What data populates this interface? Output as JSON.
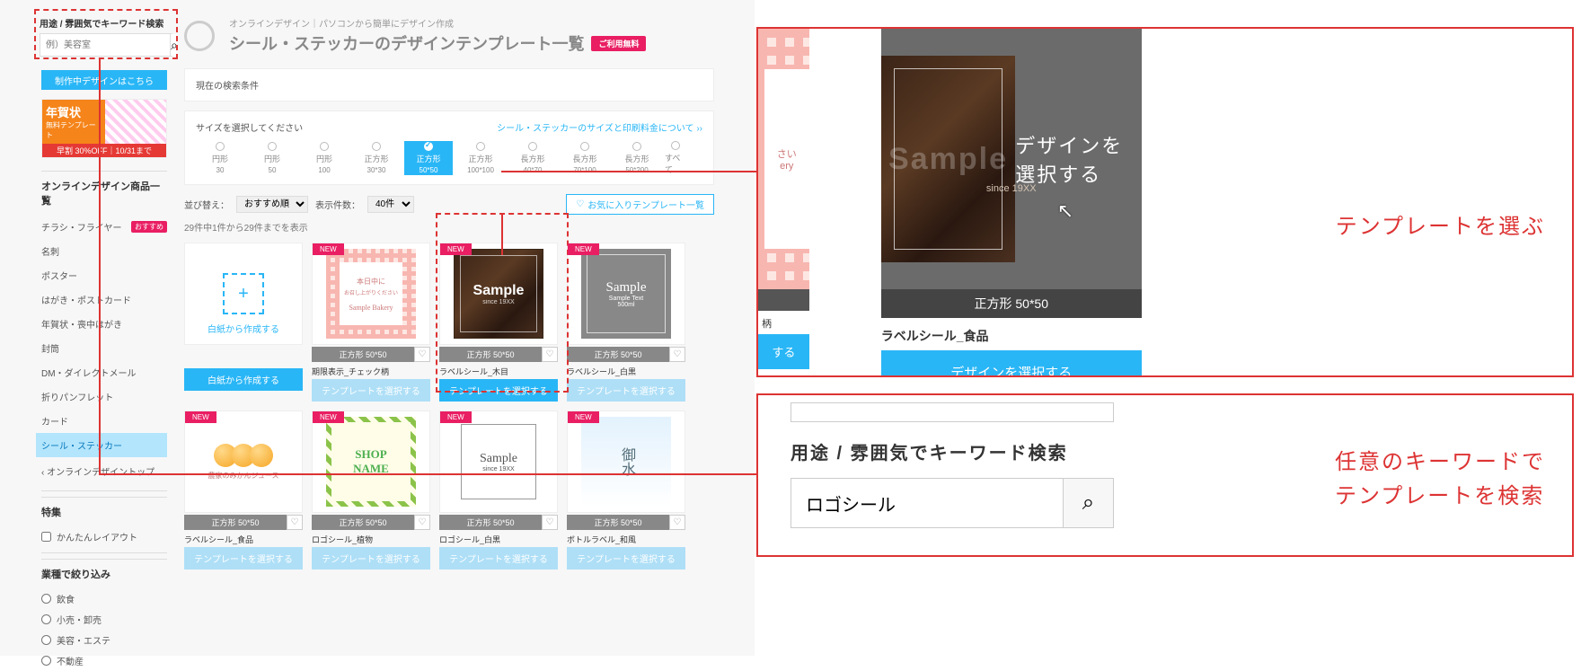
{
  "search": {
    "label": "用途 / 雰囲気でキーワード検索",
    "placeholder": "例）美容室"
  },
  "inprogress_btn": "制作中デザインはこちら",
  "promo": {
    "title": "年賀状",
    "subtitle": "無料テンプレート",
    "bottom": "早割 30%OFF｜10/31まで"
  },
  "header": {
    "breadcrumb": "オンラインデザイン｜パソコンから簡単にデザイン作成",
    "title": "シール・ステッカーのデザインテンプレート一覧",
    "free_badge": "ご利用無料"
  },
  "sidebar": {
    "products_title": "オンラインデザイン商品一覧",
    "items": [
      {
        "label": "チラシ・フライヤー",
        "badge": "おすすめ"
      },
      {
        "label": "名刺"
      },
      {
        "label": "ポスター"
      },
      {
        "label": "はがき・ポストカード"
      },
      {
        "label": "年賀状・喪中はがき"
      },
      {
        "label": "封筒"
      },
      {
        "label": "DM・ダイレクトメール"
      },
      {
        "label": "折りパンフレット"
      },
      {
        "label": "カード"
      },
      {
        "label": "シール・ステッカー",
        "active": true
      }
    ],
    "back": "オンラインデザイントップ",
    "feature_title": "特集",
    "feature_items": [
      "かんたんレイアウト"
    ],
    "industry_title": "業種で絞り込み",
    "industry_items": [
      "飲食",
      "小売・卸売",
      "美容・エステ",
      "不動産"
    ]
  },
  "cond_panel": "現在の検索条件",
  "size_panel": {
    "label": "サイズを選択してください",
    "link": "シール・ステッカーのサイズと印刷料金について",
    "all": "すべて",
    "options": [
      {
        "t1": "円形",
        "t2": "30"
      },
      {
        "t1": "円形",
        "t2": "50"
      },
      {
        "t1": "円形",
        "t2": "100"
      },
      {
        "t1": "正方形",
        "t2": "30*30"
      },
      {
        "t1": "正方形",
        "t2": "50*50",
        "selected": true
      },
      {
        "t1": "正方形",
        "t2": "100*100"
      },
      {
        "t1": "長方形",
        "t2": "40*70"
      },
      {
        "t1": "長方形",
        "t2": "70*100"
      },
      {
        "t1": "長方形",
        "t2": "50*200"
      }
    ]
  },
  "toolbar": {
    "sort_label": "並び替え：",
    "sort_value": "おすすめ順",
    "count_label": "表示件数：",
    "count_value": "40件",
    "fav": "お気に入りテンプレート一覧"
  },
  "result_count": "29件中1件から29件までを表示",
  "blank": {
    "label": "白紙から作成する",
    "btn": "白紙から作成する"
  },
  "cards": [
    {
      "thumb": "gingham",
      "new": true,
      "size": "正方形 50*50",
      "name": "期限表示_チェック柄",
      "btn": "テンプレートを選択する",
      "light": true,
      "sample": {
        "l1": "本日中に",
        "l2": "お召し上がりください",
        "l3": "Sample Bakery"
      }
    },
    {
      "thumb": "wood",
      "new": true,
      "size": "正方形 50*50",
      "name": "ラベルシール_木目",
      "btn": "テンプレートを選択する",
      "sample": {
        "big": "Sample",
        "sm": "since 19XX"
      }
    },
    {
      "thumb": "gray",
      "new": true,
      "size": "正方形 50*50",
      "name": "ラベルシール_白黒",
      "btn": "テンプレートを選択する",
      "light": true,
      "sample": {
        "big": "Sample",
        "sm1": "Sample Text",
        "sm2": "500ml"
      }
    },
    {
      "thumb": "mikan",
      "new": true,
      "size": "正方形 50*50",
      "name": "ラベルシール_食品",
      "btn": "テンプレートを選択する",
      "light": true,
      "sample": {
        "lbl": "農家のみかんジュース"
      }
    },
    {
      "thumb": "leaf",
      "new": true,
      "size": "正方形 50*50",
      "name": "ロゴシール_植物",
      "btn": "テンプレートを選択する",
      "light": true,
      "sample": {
        "big1": "SHOP",
        "big2": "NAME"
      }
    },
    {
      "thumb": "white",
      "new": true,
      "size": "正方形 50*50",
      "name": "ロゴシール_白黒",
      "btn": "テンプレートを選択する",
      "light": true,
      "sample": {
        "big": "Sample",
        "sm": "since 19XX"
      }
    },
    {
      "thumb": "wafuu",
      "new": true,
      "size": "正方形 50*50",
      "name": "ボトルラベル_和風",
      "btn": "テンプレートを選択する",
      "light": true,
      "sample": {
        "big": "御水"
      }
    }
  ],
  "callout1": {
    "left": {
      "inner1": "さい",
      "inner2": "ery",
      "name_partial": "柄",
      "btn_partial": "する"
    },
    "main": {
      "ghost": "Sample",
      "overlay": "デザインを選択する",
      "since": "since 19XX",
      "sizebar": "正方形 50*50",
      "name": "ラベルシール_食品",
      "btn": "デザインを選択する"
    },
    "label": "テンプレートを選ぶ"
  },
  "callout2": {
    "label": "用途 / 雰囲気でキーワード検索",
    "value": "ロゴシール",
    "label_lines": [
      "任意のキーワードで",
      "テンプレートを検索"
    ]
  }
}
